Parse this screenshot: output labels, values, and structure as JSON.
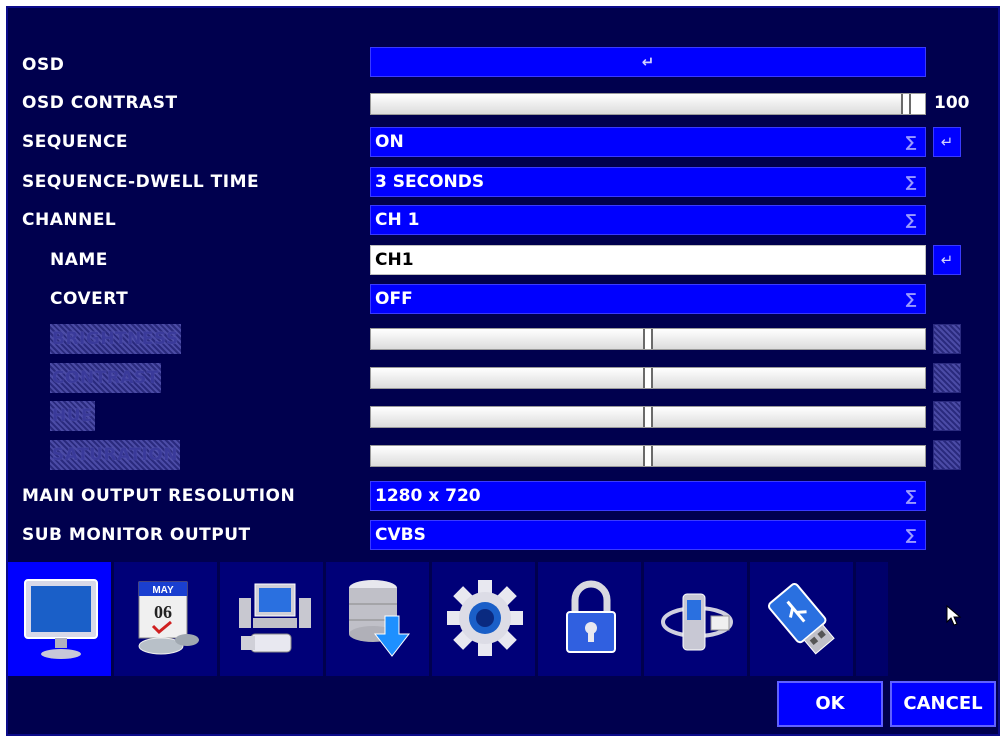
{
  "rows": {
    "osd": {
      "label": "OSD"
    },
    "osd_contrast": {
      "label": "OSD CONTRAST",
      "value": "100",
      "level": 1.0
    },
    "sequence": {
      "label": "SEQUENCE",
      "value": "ON"
    },
    "sequence_dwell": {
      "label": "SEQUENCE-DWELL TIME",
      "value": "3 SECONDS"
    },
    "channel": {
      "label": "CHANNEL",
      "value": "CH 1"
    },
    "name": {
      "label": "NAME",
      "value": "CH1"
    },
    "covert": {
      "label": "COVERT",
      "value": "OFF"
    },
    "brightness": {
      "label": "BRIGHTNESS",
      "value": "50",
      "level": 0.5
    },
    "contrast": {
      "label": "CONTRAST",
      "value": "50",
      "level": 0.5
    },
    "hue": {
      "label": "HUE",
      "value": "50",
      "level": 0.5
    },
    "saturation": {
      "label": "SATURATION",
      "value": "50",
      "level": 0.5
    },
    "main_output": {
      "label": "MAIN OUTPUT RESOLUTION",
      "value": "1280 x 720"
    },
    "sub_monitor": {
      "label": "SUB MONITOR OUTPUT",
      "value": "CVBS"
    }
  },
  "glyphs": {
    "enter": "↵",
    "dropdown": "∑"
  },
  "tabs": [
    {
      "icon": "monitor-icon",
      "active": true
    },
    {
      "icon": "calendar-icon",
      "calendar_month": "MAY",
      "calendar_day": "06"
    },
    {
      "icon": "network-computer-icon"
    },
    {
      "icon": "storage-database-icon"
    },
    {
      "icon": "gear-icon"
    },
    {
      "icon": "padlock-icon"
    },
    {
      "icon": "remote-device-icon"
    },
    {
      "icon": "usb-drive-icon"
    }
  ],
  "buttons": {
    "ok": "OK",
    "cancel": "CANCEL"
  },
  "colors": {
    "background": "#00004e",
    "field": "#0000ff",
    "active_tab": "#0000ff"
  }
}
